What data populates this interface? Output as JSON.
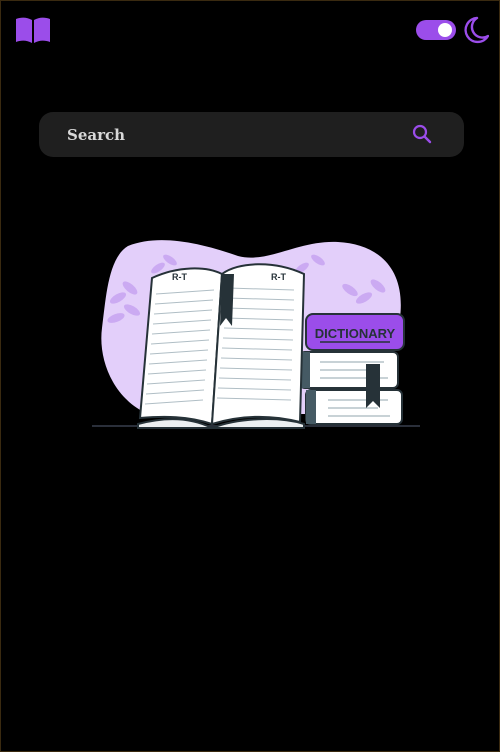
{
  "app": {
    "accent": "#9b4dea",
    "background": "#000000",
    "logo_icon": "open-book-icon"
  },
  "header": {
    "dark_mode_toggle": {
      "on": true,
      "icon": "moon-icon"
    }
  },
  "search": {
    "placeholder": "Search",
    "value": "",
    "icon": "search-icon"
  },
  "illustration": {
    "page_header_left": "R-T",
    "page_header_right": "R-T",
    "book_label": "DICTIONARY"
  }
}
